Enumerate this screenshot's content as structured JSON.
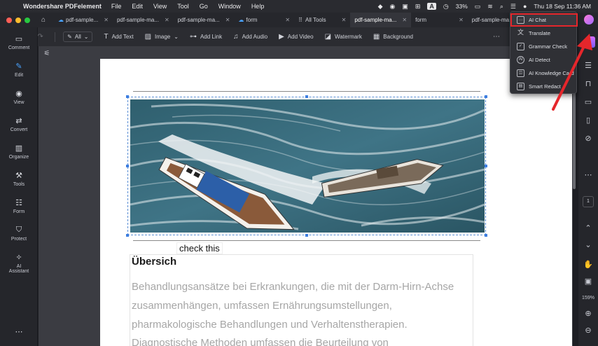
{
  "menubar": {
    "app_name": "Wondershare PDFelement",
    "menus": [
      "File",
      "Edit",
      "View",
      "Tool",
      "Go",
      "Window",
      "Help"
    ],
    "battery": "33%",
    "datetime": "Thu 18 Sep  11:36 AM",
    "input_badge": "A"
  },
  "tabs": [
    {
      "label": "pdf-sample...",
      "cloud": true
    },
    {
      "label": "pdf-sample-ma...",
      "cloud": false
    },
    {
      "label": "pdf-sample-ma...",
      "cloud": false
    },
    {
      "label": "form",
      "cloud": true
    },
    {
      "label": "All Tools",
      "cloud": false
    },
    {
      "label": "pdf-sample-ma...",
      "cloud": false,
      "active": true
    },
    {
      "label": "form",
      "cloud": false
    },
    {
      "label": "pdf-sample-ma...",
      "cloud": false
    }
  ],
  "toolbar": {
    "all_label": "All",
    "add_text": "Add Text",
    "image": "Image",
    "add_link": "Add Link",
    "add_audio": "Add Audio",
    "add_video": "Add Video",
    "watermark": "Watermark",
    "background": "Background"
  },
  "sidebar": {
    "items": [
      {
        "label": "Comment",
        "icon": "comment-icon"
      },
      {
        "label": "Edit",
        "icon": "edit-icon"
      },
      {
        "label": "View",
        "icon": "view-icon"
      },
      {
        "label": "Convert",
        "icon": "convert-icon"
      },
      {
        "label": "Organize",
        "icon": "organize-icon"
      },
      {
        "label": "Tools",
        "icon": "tools-icon"
      },
      {
        "label": "Form",
        "icon": "form-icon"
      },
      {
        "label": "Protect",
        "icon": "protect-icon"
      },
      {
        "label": "AI Assistant",
        "icon": "ai-assistant-icon"
      }
    ]
  },
  "document": {
    "callout": "check this",
    "heading": "Übersich",
    "lines": [
      "Behandlungsansätze bei Erkrankungen, die mit der Darm-Hirn-Achse",
      "zusammenhängen, umfassen Ernährungsumstellungen,",
      "pharmakologische Behandlungen und Verhaltenstherapien.",
      "Diagnostische Methoden umfassen die Beurteilung von"
    ]
  },
  "right_rail": {
    "page": "1",
    "zoom": "159%"
  },
  "dropdown": {
    "items": [
      {
        "label": "AI Chat",
        "icon": "ai-chat-icon",
        "highlighted": true
      },
      {
        "label": "Translate",
        "icon": "translate-icon"
      },
      {
        "label": "Grammar Check",
        "icon": "grammar-check-icon"
      },
      {
        "label": "AI Detect",
        "icon": "ai-detect-icon"
      },
      {
        "label": "AI Knowledge Card",
        "icon": "ai-knowledge-card-icon"
      },
      {
        "label": "Smart Redact",
        "icon": "smart-redact-icon"
      }
    ]
  },
  "colors": {
    "accent": "#4aa3ff",
    "highlight_outline": "#e5262b",
    "arrow": "#e5262b"
  }
}
